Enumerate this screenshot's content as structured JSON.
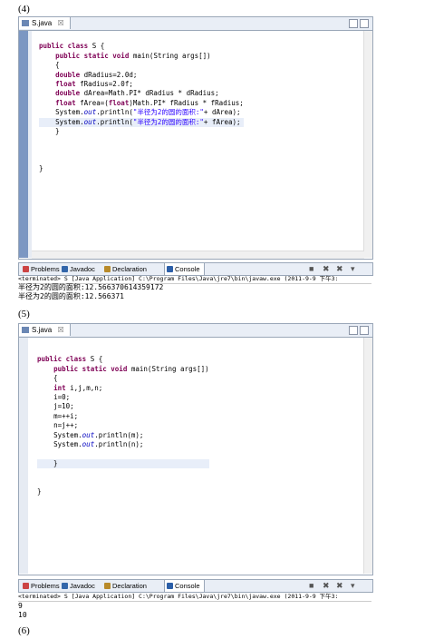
{
  "labels": {
    "l4": "(4)",
    "l5": "(5)",
    "l6": "(6)"
  },
  "panel4": {
    "tab_label": "S.java",
    "tab_close": "☒",
    "code_lines": [
      "",
      "public class S {",
      "    public static void main(String args[])",
      "    {",
      "    double dRadius=2.0d;",
      "    float fRadius=2.0f;",
      "    double dArea=Math.PI* dRadius * dRadius;",
      "    float fArea=(float)Math.PI* fRadius * fRadius;",
      "    System.out.println(\"半径为2的圆的面积:\"+ dArea);",
      "    System.out.println(\"半径为2的圆的面积:\"+ fArea);",
      "    }",
      "",
      "",
      "",
      "}"
    ],
    "console_tabs": [
      "Problems",
      "Javadoc",
      "Declaration",
      "Console"
    ],
    "terminated": "<terminated> S [Java Application] C:\\Program Files\\Java\\jre7\\bin\\javaw.exe (2011-9-9 下午3:",
    "output": [
      "半径为2的圆的面积:12.566370614359172",
      "半径为2的圆的面积:12.566371"
    ]
  },
  "panel5": {
    "tab_label": "S.java",
    "tab_close": "☒",
    "code_lines": [
      "",
      "public class S {",
      "    public static void main(String args[])",
      "    {",
      "    int i,j,m,n;",
      "    i=0;",
      "    j=10;",
      "    m=++i;",
      "    n=j++;",
      "    System.out.println(m);",
      "    System.out.println(n);",
      "",
      "    }",
      "",
      "",
      "}"
    ],
    "console_tabs": [
      "Problems",
      "Javadoc",
      "Declaration",
      "Console"
    ],
    "terminated": "<terminated> S [Java Application] C:\\Program Files\\Java\\jre7\\bin\\javaw.exe (2011-9-9 下午3:",
    "output": [
      "9",
      "10"
    ]
  },
  "colors": {
    "keyword": "#7f0055",
    "string": "#2a00ff",
    "field": "#0000c0",
    "gutter": "#7c97c2"
  }
}
